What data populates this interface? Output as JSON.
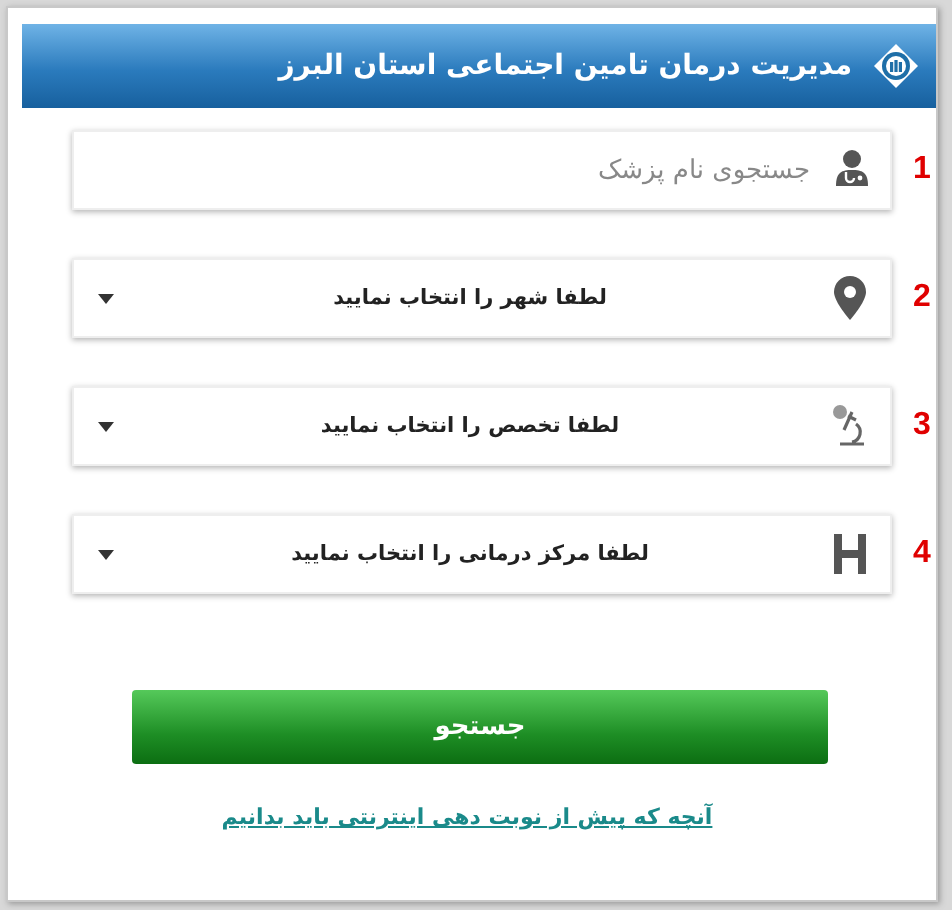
{
  "header": {
    "title": "مدیریت درمان تامین اجتماعی استان البرز"
  },
  "fields": [
    {
      "kind": "search",
      "marker": "1",
      "placeholder": "جستجوی نام پزشک"
    },
    {
      "kind": "select",
      "marker": "2",
      "value": "لطفا شهر را انتخاب نمایید"
    },
    {
      "kind": "select",
      "marker": "3",
      "value": "لطفا تخصص را انتخاب نمایید"
    },
    {
      "kind": "select",
      "marker": "4",
      "value": "لطفا مرکز درمانی را انتخاب نمایید"
    }
  ],
  "search_button": {
    "label": "جستجو"
  },
  "help_link": {
    "label": "آنچه که پیش از نوبت دهی اینترنتی باید بدانیم"
  }
}
